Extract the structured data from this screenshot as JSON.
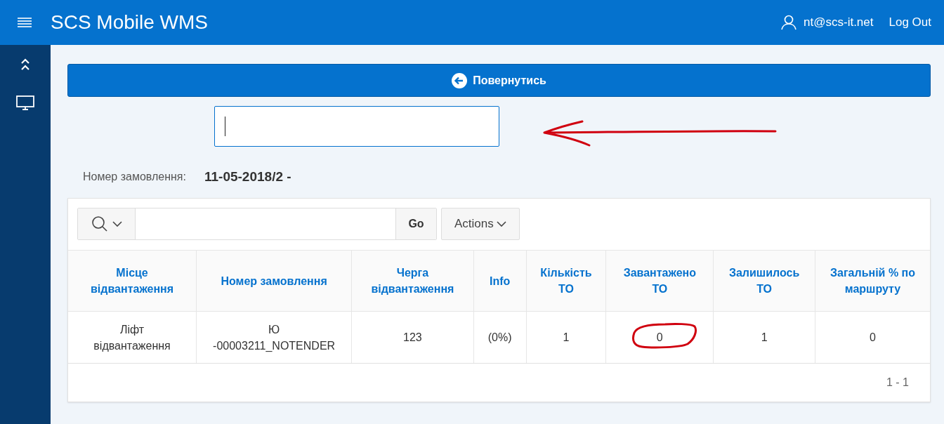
{
  "header": {
    "title": "SCS Mobile WMS",
    "user": "nt@scs-it.net",
    "logout": "Log Out"
  },
  "back_button": {
    "label": "Повернутись"
  },
  "order": {
    "label": "Номер замовлення:",
    "value": "11-05-2018/2 -"
  },
  "report": {
    "go_button": "Go",
    "actions_button": "Actions",
    "columns": [
      {
        "label": "Місце відвантаження"
      },
      {
        "label": "Номер замовлення"
      },
      {
        "label": "Черга відвантаження"
      },
      {
        "label": "Info"
      },
      {
        "label": "Кількість ТО"
      },
      {
        "label": "Завантажено ТО"
      },
      {
        "label": "Залишилось ТО"
      },
      {
        "label": "Загальній % по маршруту"
      }
    ],
    "rows": [
      {
        "cells": [
          "Ліфт відвантаження",
          "Ю -00003211_NOTENDER",
          "123",
          "(0%)",
          "1",
          "0",
          "1",
          "0"
        ]
      }
    ],
    "pagination": "1 - 1"
  }
}
